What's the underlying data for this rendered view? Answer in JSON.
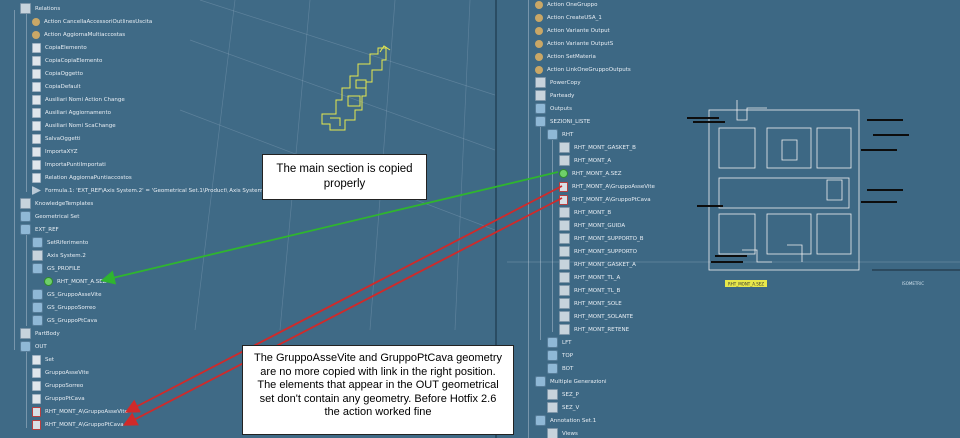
{
  "left_tree": {
    "items": [
      {
        "label": "Relations"
      },
      {
        "label": "Action CancellaAccessoriOutlinesUscita"
      },
      {
        "label": "Action AggiornaMultiaccostas"
      },
      {
        "label": "CopiaElemento"
      },
      {
        "label": "CopiaCopiaElemento"
      },
      {
        "label": "CopiaOggetto"
      },
      {
        "label": "CopiaDefault"
      },
      {
        "label": "Ausiliari Nomi Action Change"
      },
      {
        "label": "Ausiliari Aggiornamento"
      },
      {
        "label": "Ausiliari Nomi ScaChange"
      },
      {
        "label": "SalvaOggetti"
      },
      {
        "label": "ImportaXYZ"
      },
      {
        "label": "ImportaPuntiImportati"
      },
      {
        "label": "Relation AggiornaPuntiaccostos"
      },
      {
        "label": "Formula.1: 'EXT_REF\\Axis System.2' = 'Geometrical Set.1\\Product\\ Axis System'"
      },
      {
        "label": "KnowledgeTemplates"
      },
      {
        "label": "Geometrical Set"
      },
      {
        "label": "EXT_REF"
      },
      {
        "label": "SetRiferimento"
      },
      {
        "label": "Axis System.2"
      },
      {
        "label": "GS_PROFILE"
      },
      {
        "label": "RHT_MONT_A.SEZ"
      },
      {
        "label": "GS_GruppoAsseVite"
      },
      {
        "label": "GS_GruppoSorreo"
      },
      {
        "label": "GS_GruppoPtCava"
      },
      {
        "label": "PartBody"
      },
      {
        "label": "OUT"
      },
      {
        "label": "Set"
      },
      {
        "label": "GruppoAsseVite"
      },
      {
        "label": "GruppoSorreo"
      },
      {
        "label": "GruppoPtCava"
      },
      {
        "label": "RHT_MONT_A\\GruppoAsseVite"
      },
      {
        "label": "RHT_MONT_A\\GruppoPtCava"
      }
    ]
  },
  "right_tree": {
    "items": [
      {
        "label": "Action OneGruppo"
      },
      {
        "label": "Action CreateUSA_1"
      },
      {
        "label": "Action Variante Output"
      },
      {
        "label": "Action Variante OutputS"
      },
      {
        "label": "Action SetMateria"
      },
      {
        "label": "Action LinkOneGruppoOutputs"
      },
      {
        "label": "PowerCopy"
      },
      {
        "label": "Parteady"
      },
      {
        "label": "Outputs"
      },
      {
        "label": "SEZIONI_LISTE"
      },
      {
        "label": "RHT"
      },
      {
        "label": "RHT_MONT_GASKET_B"
      },
      {
        "label": "RHT_MONT_A"
      },
      {
        "label": "RHT_MONT_A.SEZ"
      },
      {
        "label": "RHT_MONT_A\\GruppoAsseVite"
      },
      {
        "label": "RHT_MONT_A\\GruppoPtCava"
      },
      {
        "label": "RHT_MONT_B"
      },
      {
        "label": "RHT_MONT_GUIDA"
      },
      {
        "label": "RHT_MONT_SUPPORTO_B"
      },
      {
        "label": "RHT_MONT_SUPPORTO"
      },
      {
        "label": "RHT_MONT_GASKET_A"
      },
      {
        "label": "RHT_MONT_TL_A"
      },
      {
        "label": "RHT_MONT_TL_B"
      },
      {
        "label": "RHT_MONT_SOLE"
      },
      {
        "label": "RHT_MONT_SOLANTE"
      },
      {
        "label": "RHT_MONT_RETENE"
      },
      {
        "label": "LFT"
      },
      {
        "label": "TOP"
      },
      {
        "label": "BOT"
      },
      {
        "label": "Multiple Generazioni"
      },
      {
        "label": "SEZ_P"
      },
      {
        "label": "SEZ_V"
      },
      {
        "label": "Annotation Set.1"
      },
      {
        "label": "Views"
      }
    ]
  },
  "viewport_labels": {
    "left_label": "RHT_MONT_A.SEZ",
    "right_label": "ISOMETRIC"
  },
  "callouts": {
    "small": "The main section is copied properly",
    "big": "The GruppoAsseVite and GruppoPtCava geometry are no more copied with link in the right position. The elements that appear in the OUT geometrical set don't contain any geometry. Before Hotfix 2.6 the action worked fine"
  },
  "colors": {
    "background": "#3f6a86",
    "green_arrow": "#2fb52f",
    "red_arrow": "#d02a2a",
    "yellow_geometry": "#e8e84a"
  }
}
